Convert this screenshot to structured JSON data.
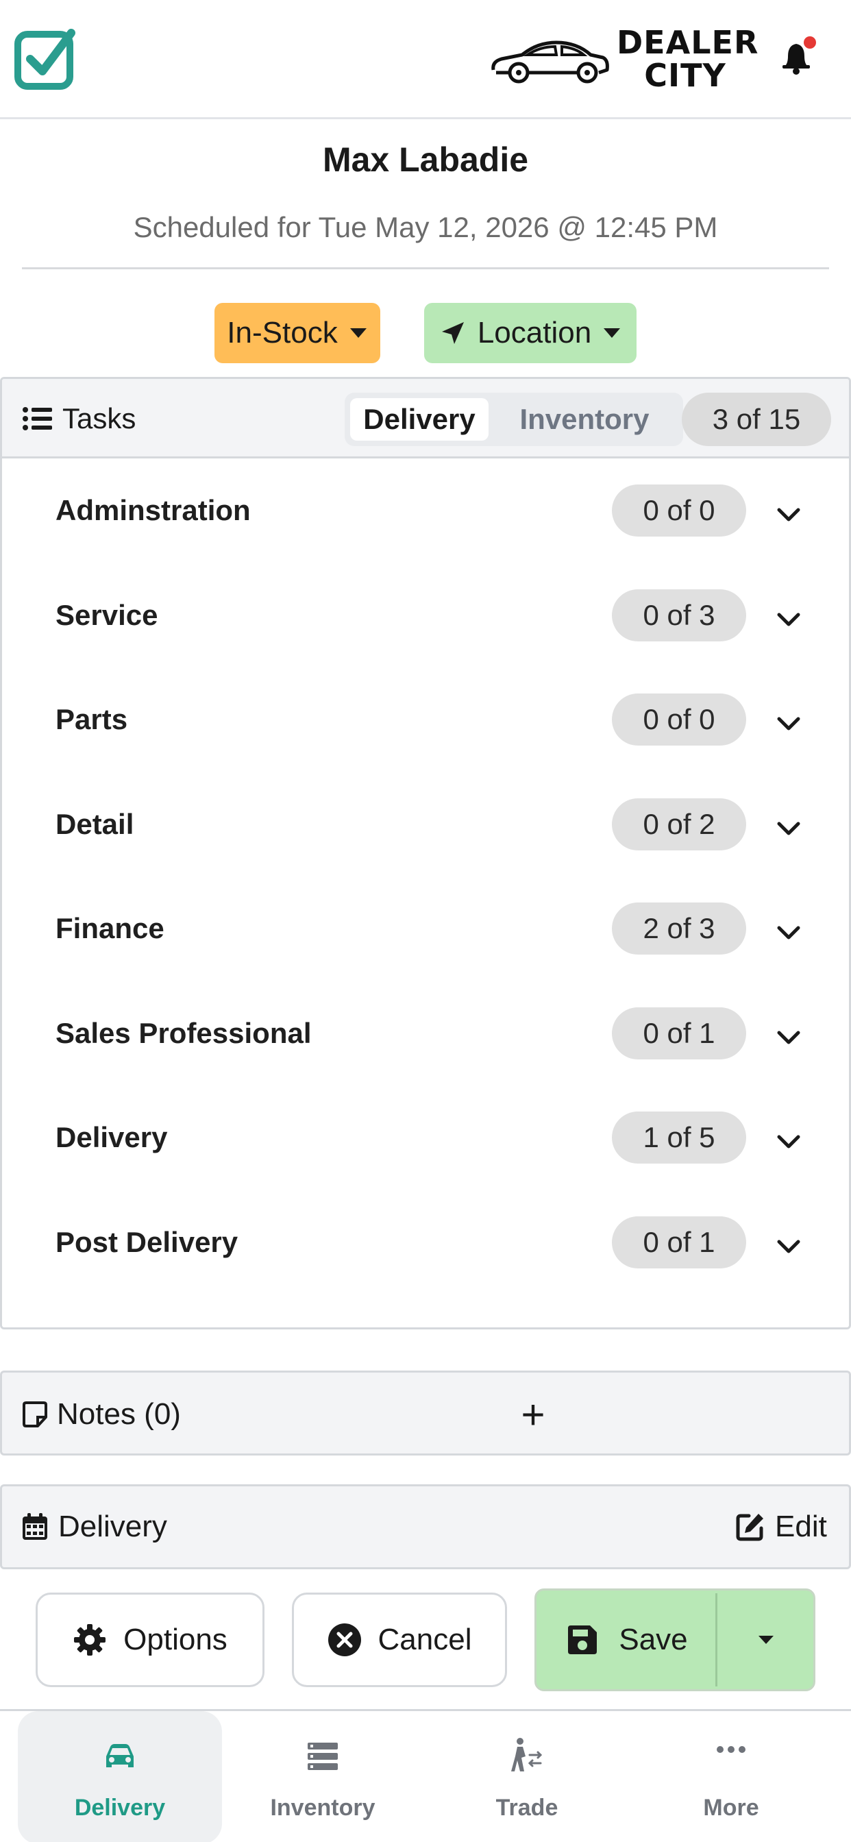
{
  "header": {
    "brand_line1": "DEALER",
    "brand_line2": "CITY",
    "notification_dot_color": "#e53935",
    "logo_color": "#2a9d8f"
  },
  "customer": {
    "name": "Max Labadie",
    "schedule": "Scheduled for Tue May 12, 2026 @ 12:45 PM"
  },
  "status_buttons": {
    "stock_label": "In-Stock",
    "location_label": "Location"
  },
  "tasks": {
    "title": "Tasks",
    "segments": [
      "Delivery",
      "Inventory"
    ],
    "active_segment": "Delivery",
    "progress": "3 of 15",
    "items": [
      {
        "label": "Adminstration",
        "count": "0 of 0"
      },
      {
        "label": "Service",
        "count": "0 of 3"
      },
      {
        "label": "Parts",
        "count": "0 of 0"
      },
      {
        "label": "Detail",
        "count": "0 of 2"
      },
      {
        "label": "Finance",
        "count": "2 of 3"
      },
      {
        "label": "Sales Professional",
        "count": "0 of 1"
      },
      {
        "label": "Delivery",
        "count": "1 of 5"
      },
      {
        "label": "Post Delivery",
        "count": "0 of 1"
      }
    ]
  },
  "notes": {
    "title": "Notes (0)",
    "add_label": "+"
  },
  "delivery_section": {
    "title": "Delivery",
    "edit_label": "Edit"
  },
  "actions": {
    "options_label": "Options",
    "cancel_label": "Cancel",
    "save_label": "Save"
  },
  "bottom_nav": {
    "items": [
      {
        "label": "Delivery",
        "icon": "car-icon",
        "active": true
      },
      {
        "label": "Inventory",
        "icon": "list-icon",
        "active": false
      },
      {
        "label": "Trade",
        "icon": "trade-icon",
        "active": false
      },
      {
        "label": "More",
        "icon": "more-icon",
        "active": false
      }
    ],
    "accent_color": "#1f9a86"
  }
}
